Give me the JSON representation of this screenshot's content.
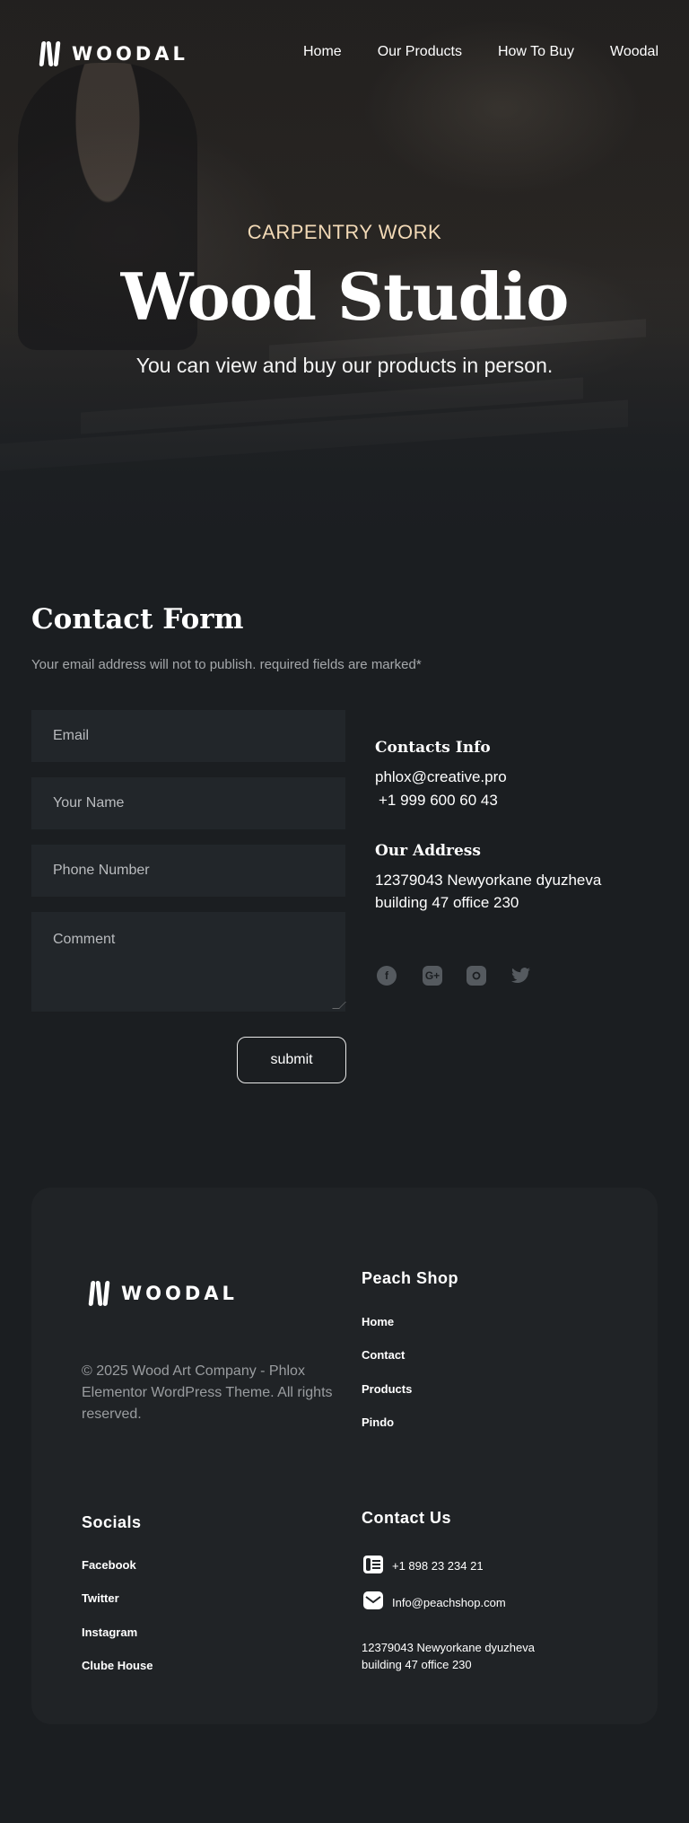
{
  "brand": {
    "name": "WOODAL"
  },
  "nav": [
    "Home",
    "Our Products",
    "How To Buy",
    "Woodal"
  ],
  "hero": {
    "eyebrow": "CARPENTRY WORK",
    "title": "Wood Studio",
    "subtitle": "You can view and buy our products in person."
  },
  "contact": {
    "title": "Contact Form",
    "description": "Your email address will not to publish. required fields are marked*",
    "fields": {
      "email_placeholder": "Email",
      "name_placeholder": "Your Name",
      "phone_placeholder": "Phone Number",
      "comment_placeholder": "Comment"
    },
    "submit_label": "submit",
    "info_title": "Contacts Info",
    "email": "phlox@creative.pro",
    "phone": "+1 999 600 60 43",
    "address_title": "Our Address",
    "address_line1": "12379043 Newyorkane dyuzheva",
    "address_line2": "building 47 office 230",
    "socials": [
      "facebook-icon",
      "google-plus-icon",
      "instagram-icon",
      "twitter-icon"
    ]
  },
  "footer": {
    "copyright": "© 2025 Wood Art Company - Phlox Elementor WordPress Theme. All rights reserved.",
    "shop_title": "Peach Shop",
    "shop_links": [
      "Home",
      "Contact",
      "Products",
      "Pindo"
    ],
    "socials_title": "Socials",
    "social_links": [
      "Facebook",
      "Twitter",
      "Instagram",
      "Clube House"
    ],
    "contact_title": "Contact Us",
    "phone": "+1 898 23 234 21",
    "email": "Info@peachshop.com",
    "address_line1": "12379043 Newyorkane dyuzheva",
    "address_line2": "building 47 office 230"
  },
  "colors": {
    "background": "#1b1e21",
    "field": "#22262a",
    "card": "#202326",
    "accent": "#f2d9b6"
  }
}
